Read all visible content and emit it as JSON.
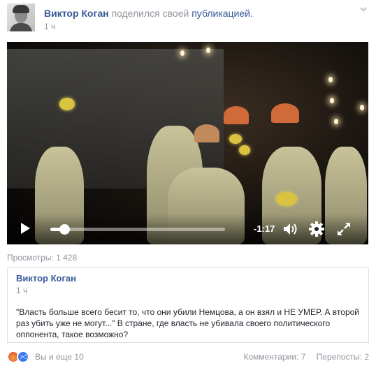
{
  "post": {
    "author": "Виктор Коган",
    "verb": "поделился своей",
    "shared_object": "публикацией.",
    "time": "1 ч"
  },
  "video": {
    "duration": "-1:17",
    "progress": 0.08,
    "icons": [
      "play-icon",
      "volume-icon",
      "gear-icon",
      "fullscreen-icon"
    ]
  },
  "views_label": "Просмотры: 1 428",
  "shared_post": {
    "author": "Виктор Коган",
    "time": "1 ч",
    "text": "\"Власть больше всего бесит то, что они убили Немцова, а он взял и НЕ УМЕР. А второй раз убить уже не могут...\" В стране, где власть не убивала своего политического оппонента, такое возможно?"
  },
  "footer": {
    "reactions": [
      "angry-icon",
      "like-icon"
    ],
    "reactions_text": "Вы и еще 10",
    "comments": "Комментарии: 7",
    "shares": "Перепосты: 2"
  },
  "colors": {
    "link": "#365899",
    "muted": "#90949c",
    "border": "#dddfe2"
  }
}
